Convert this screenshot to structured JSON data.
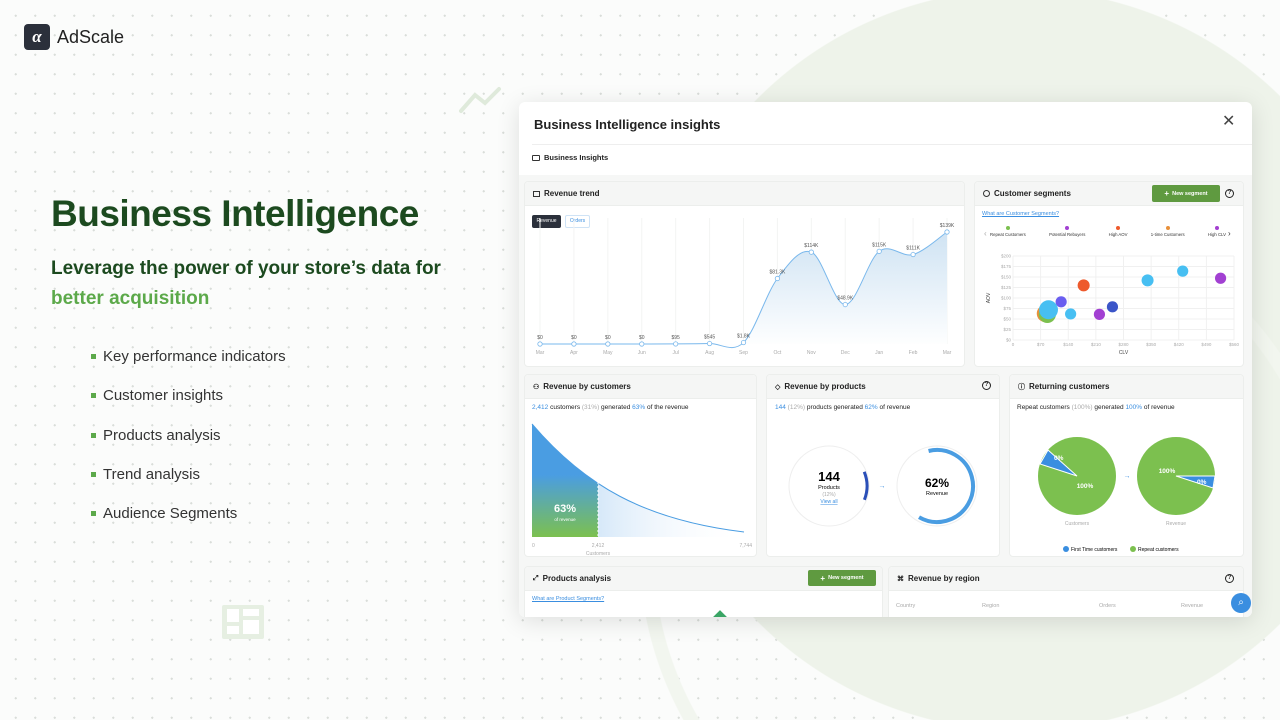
{
  "brand": {
    "logo_glyph": "α",
    "name": "AdScale"
  },
  "hero": {
    "title": "Business Intelligence",
    "subtitle_line1": "Leverage the power of your store’s data for",
    "subtitle_accent": "better acquisition",
    "bullets": [
      "Key performance indicators",
      "Customer insights",
      "Products analysis",
      "Trend analysis",
      "Audience Segments"
    ]
  },
  "window": {
    "title": "Business Intelligence insights",
    "close_icon": "close-icon",
    "breadcrumb": "Business Insights"
  },
  "revenue_trend": {
    "title": "Revenue trend",
    "tabs": [
      "Revenue",
      "Orders"
    ],
    "active_tab": "Revenue"
  },
  "customer_segments": {
    "title": "Customer segments",
    "new_segment": "New segment",
    "help_link": "What are Customer Segments?"
  },
  "revenue_by_customers": {
    "count": "2,412",
    "label_customers": "customers",
    "pct_customers": "(31%)",
    "generated": "generated",
    "pct_revenue": "63%",
    "of_revenue": "of the revenue",
    "title": "Revenue by customers",
    "big_pct": "63%",
    "big_caption": "of revenue",
    "axis": [
      "0",
      "2,412",
      "7,744"
    ],
    "axis_title": "Customers",
    "share": 0.63
  },
  "revenue_by_products": {
    "title": "Revenue by products",
    "count": "144",
    "pct": "(12%)",
    "text_mid": "products generated",
    "pct_revenue": "62%",
    "text_end": "of revenue",
    "ring_count": "144",
    "ring_label": "Products",
    "ring_pct": "(12%)",
    "view_all": "View all",
    "rev_pct": "62%",
    "rev_label": "Revenue",
    "products_share": 0.12,
    "revenue_share": 0.62
  },
  "returning_customers": {
    "title": "Returning customers",
    "lead": "Repeat customers",
    "pct": "(100%)",
    "generated": "generated",
    "pct_revenue": "100%",
    "end": "of revenue",
    "pie_customers": {
      "first": "0%",
      "repeat": "100%",
      "caption": "Customers"
    },
    "pie_revenue": {
      "first": "0%",
      "repeat": "100%",
      "caption": "Revenue"
    },
    "legend": [
      {
        "label": "First Time customers",
        "color": "#3a8ee0"
      },
      {
        "label": "Repeat customers",
        "color": "#7cc04f"
      }
    ]
  },
  "products_analysis": {
    "title": "Products analysis",
    "new_segment": "New segment",
    "help_link": "What are Product Segments?"
  },
  "revenue_by_region": {
    "title": "Revenue by region",
    "columns": [
      "Country",
      "Region",
      "Orders",
      "Revenue"
    ]
  },
  "chart_data": [
    {
      "type": "area",
      "title": "Revenue trend",
      "categories": [
        "Mar",
        "Apr",
        "May",
        "Jun",
        "Jul",
        "Aug",
        "Sep",
        "Oct",
        "Nov",
        "Dec",
        "Jan",
        "Feb",
        "Mar"
      ],
      "values": [
        0,
        0,
        0,
        0,
        95,
        545,
        1800,
        81300,
        114000,
        48900,
        115000,
        111000,
        139000
      ],
      "labels": [
        "$0",
        "$0",
        "$0",
        "$0",
        "$95",
        "$545",
        "$1.8K",
        "$81.3K",
        "$114K",
        "$48.9K",
        "$115K",
        "$111K",
        "$139K"
      ],
      "ylim": [
        0,
        139000
      ],
      "color": "#7ab8ec"
    },
    {
      "type": "scatter",
      "title": "Customer segments",
      "xlabel": "CLV",
      "ylabel": "AOV",
      "xlim": [
        0,
        560
      ],
      "ylim": [
        0,
        200
      ],
      "xticks": [
        "0",
        "$70",
        "$140",
        "$210",
        "$280",
        "$350",
        "$420",
        "$490",
        "$560"
      ],
      "yticks": [
        "$0",
        "$25",
        "$50",
        "$75",
        "$100",
        "$125",
        "$150",
        "$175",
        "$200"
      ],
      "legend": [
        {
          "name": "Repeat Customers",
          "color": "#7cc04f"
        },
        {
          "name": "Potential Rebuyers",
          "color": "#a240d2"
        },
        {
          "name": "High AOV",
          "color": "#ee5a2c"
        },
        {
          "name": "1-time Customers",
          "color": "#e8903a"
        },
        {
          "name": "High CLV",
          "color": "#a33fd0"
        }
      ],
      "points": [
        {
          "x": 82,
          "y": 63,
          "color": "#e8903a",
          "size": 2
        },
        {
          "x": 87,
          "y": 61,
          "color": "#7cc04f",
          "size": 2
        },
        {
          "x": 90,
          "y": 72,
          "color": "#47bff2",
          "size": 2.2
        },
        {
          "x": 122,
          "y": 91,
          "color": "#6a5ef0",
          "size": 1.3
        },
        {
          "x": 146,
          "y": 62,
          "color": "#47bff2",
          "size": 1.3
        },
        {
          "x": 179,
          "y": 130,
          "color": "#ee5a2c",
          "size": 1.4
        },
        {
          "x": 219,
          "y": 61,
          "color": "#a240d2",
          "size": 1.3
        },
        {
          "x": 252,
          "y": 79,
          "color": "#3b55c8",
          "size": 1.3
        },
        {
          "x": 341,
          "y": 142,
          "color": "#47bff2",
          "size": 1.4
        },
        {
          "x": 430,
          "y": 164,
          "color": "#47bff2",
          "size": 1.3
        },
        {
          "x": 526,
          "y": 147,
          "color": "#a240d2",
          "size": 1.3
        }
      ]
    }
  ]
}
